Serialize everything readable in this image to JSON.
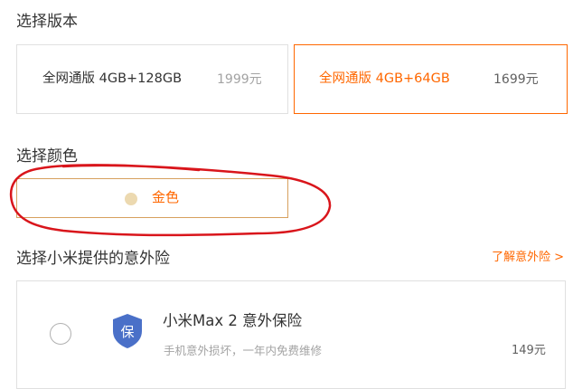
{
  "version_section": {
    "title": "选择版本",
    "options": [
      {
        "name": "全网通版 4GB+128GB",
        "price": "1999元",
        "selected": false
      },
      {
        "name": "全网通版 4GB+64GB",
        "price": "1699元",
        "selected": true
      }
    ]
  },
  "color_section": {
    "title": "选择颜色",
    "options": [
      {
        "label": "金色",
        "swatch_color": "#ecd9b0",
        "selected": true
      }
    ]
  },
  "insurance_section": {
    "title": "选择小米提供的意外险",
    "learn_more": "了解意外险",
    "learn_more_chevron": ">",
    "items": [
      {
        "icon": "shield-icon",
        "icon_text": "保",
        "name": "小米Max 2 意外保险",
        "description": "手机意外损坏，一年内免费维修",
        "price": "149元"
      }
    ]
  },
  "colors": {
    "accent": "#ff6700",
    "annotation_red": "#d9151b",
    "shield_blue": "#4a70c8"
  }
}
